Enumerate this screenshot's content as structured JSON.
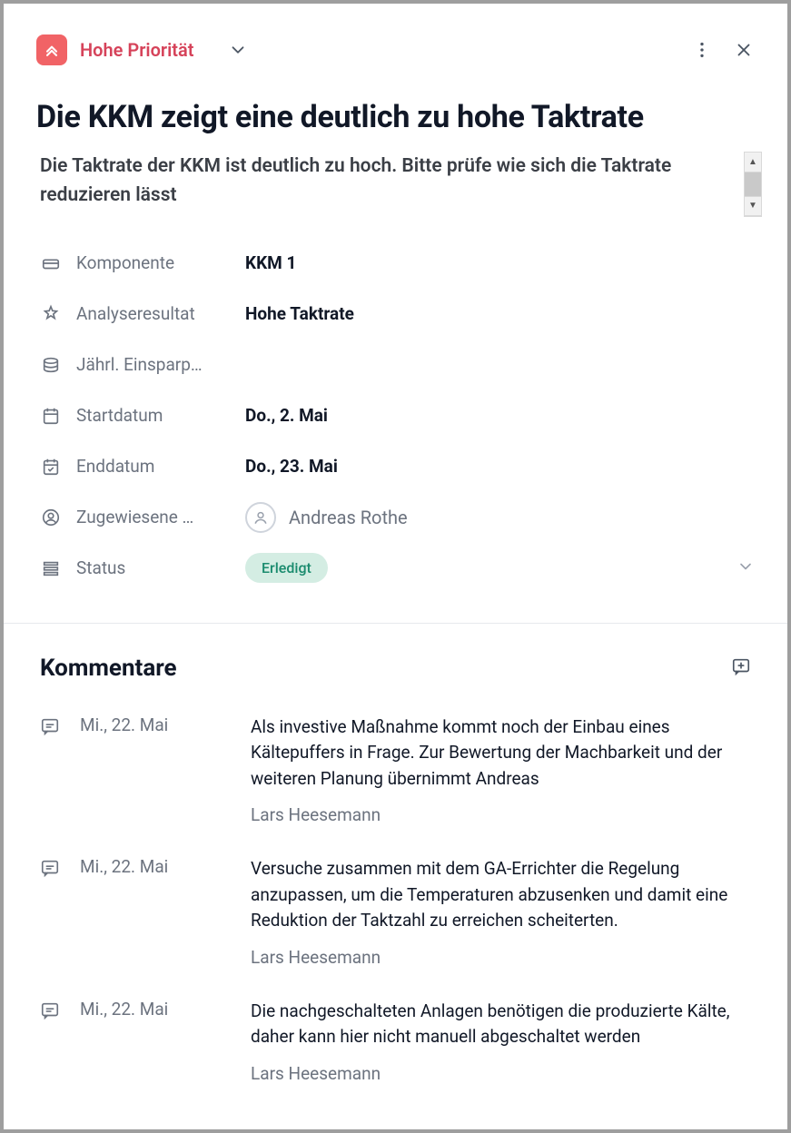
{
  "header": {
    "priority_label": "Hohe Priorität"
  },
  "title": "Die KKM zeigt eine deutlich zu hohe Taktrate",
  "description": "Die Taktrate der KKM ist deutlich zu hoch. Bitte prüfe wie sich die Taktrate reduzieren lässt",
  "meta": {
    "component_label": "Komponente",
    "component_value": "KKM 1",
    "analysis_label": "Analyseresultat",
    "analysis_value": "Hohe Taktrate",
    "savings_label": "Jährl. Einsparp…",
    "savings_value": "",
    "start_label": "Startdatum",
    "start_value": "Do., 2. Mai",
    "end_label": "Enddatum",
    "end_value": "Do., 23. Mai",
    "assignee_label": "Zugewiesene …",
    "assignee_value": "Andreas Rothe",
    "status_label": "Status",
    "status_value": "Erledigt"
  },
  "comments_title": "Kommentare",
  "comments": [
    {
      "date": "Mi., 22. Mai",
      "text": "Als investive Maßnahme kommt noch der Einbau eines Kältepuffers in Frage. Zur Bewertung der Machbarkeit und der weiteren Planung übernimmt Andreas",
      "author": "Lars Heesemann"
    },
    {
      "date": "Mi., 22. Mai",
      "text": "Versuche zusammen mit dem GA-Errichter die Regelung anzupassen, um die Temperaturen abzusenken und damit eine Reduktion der Taktzahl zu erreichen scheiterten.",
      "author": "Lars Heesemann"
    },
    {
      "date": "Mi., 22. Mai",
      "text": "Die nachgeschalteten Anlagen benötigen die produzierte Kälte, daher kann hier nicht manuell abgeschaltet werden",
      "author": "Lars Heesemann"
    }
  ]
}
